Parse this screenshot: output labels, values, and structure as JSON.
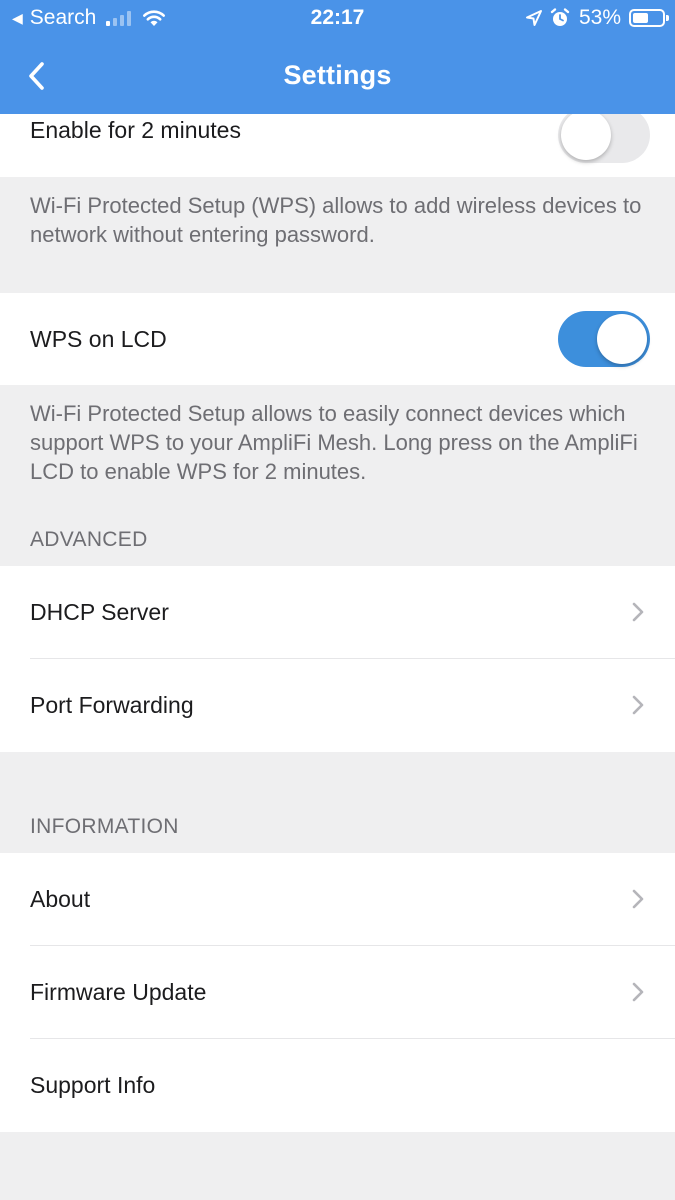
{
  "status_bar": {
    "back_app_label": "Search",
    "time": "22:17",
    "battery_percent": "53%",
    "signal_bars_active": 1,
    "battery_level": 0.53
  },
  "nav": {
    "title": "Settings",
    "back_icon": "chevron-left-icon"
  },
  "wps_button": {
    "label": "Enable for 2 minutes",
    "enabled": false,
    "description": "Wi-Fi Protected Setup (WPS) allows to add wireless devices to network without entering password."
  },
  "wps_lcd": {
    "label": "WPS on LCD",
    "enabled": true,
    "description": "Wi-Fi Protected Setup allows to easily connect devices which support WPS to your AmpliFi Mesh. Long press on the AmpliFi LCD to enable WPS for 2 minutes."
  },
  "advanced": {
    "header": "ADVANCED",
    "items": [
      {
        "label": "DHCP Server",
        "icon": "chevron-right-icon"
      },
      {
        "label": "Port Forwarding",
        "icon": "chevron-right-icon"
      }
    ]
  },
  "information": {
    "header": "INFORMATION",
    "items": [
      {
        "label": "About",
        "icon": "chevron-right-icon"
      },
      {
        "label": "Firmware Update",
        "icon": "chevron-right-icon"
      },
      {
        "label": "Support Info"
      }
    ]
  },
  "colors": {
    "nav_background": "#4a93e8",
    "toggle_on": "#3d8fdc",
    "toggle_off": "#e9e9eb",
    "group_background": "#efeff0",
    "secondary_text": "#6e6e73"
  }
}
